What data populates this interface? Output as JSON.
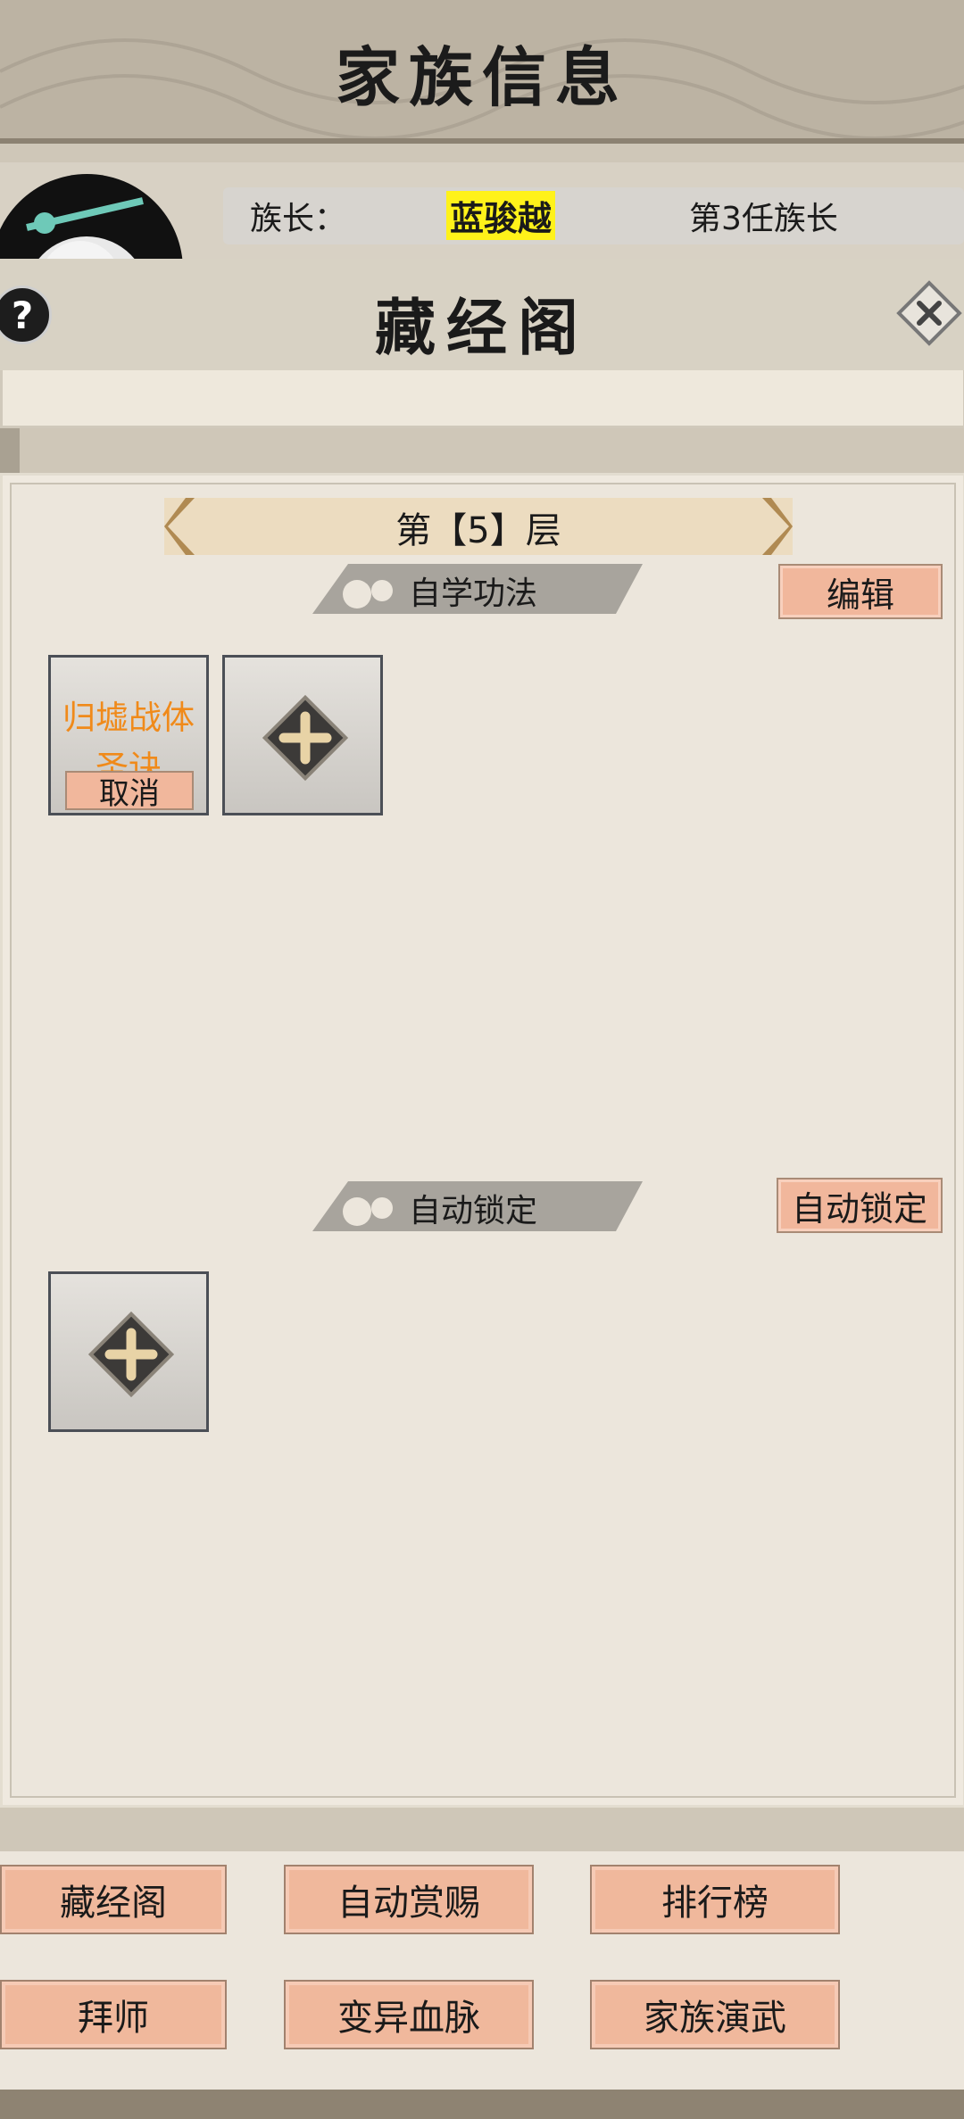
{
  "header": {
    "title": "家族信息"
  },
  "leader": {
    "label": "族长：",
    "name": "蓝骏越",
    "rank": "第3任族长"
  },
  "modal": {
    "title": "藏经阁",
    "help_glyph": "?",
    "floor_label": "第【5】层",
    "self_study": {
      "ribbon_label": "自学功法",
      "edit_label": "编辑",
      "slots": [
        {
          "skill": "归墟战体圣诀",
          "cancel_label": "取消"
        },
        {
          "empty": true
        }
      ]
    },
    "auto_lock": {
      "ribbon_label": "自动锁定",
      "button_label": "自动锁定"
    }
  },
  "bottom_buttons": {
    "row1": [
      "藏经阁",
      "自动赏赐",
      "排行榜"
    ],
    "row2": [
      "拜师",
      "变异血脉",
      "家族演武"
    ]
  },
  "colors": {
    "skill_text": "#f08a1a",
    "leader_highlight": "#fff21a",
    "button_bg": "#f1b79c"
  }
}
